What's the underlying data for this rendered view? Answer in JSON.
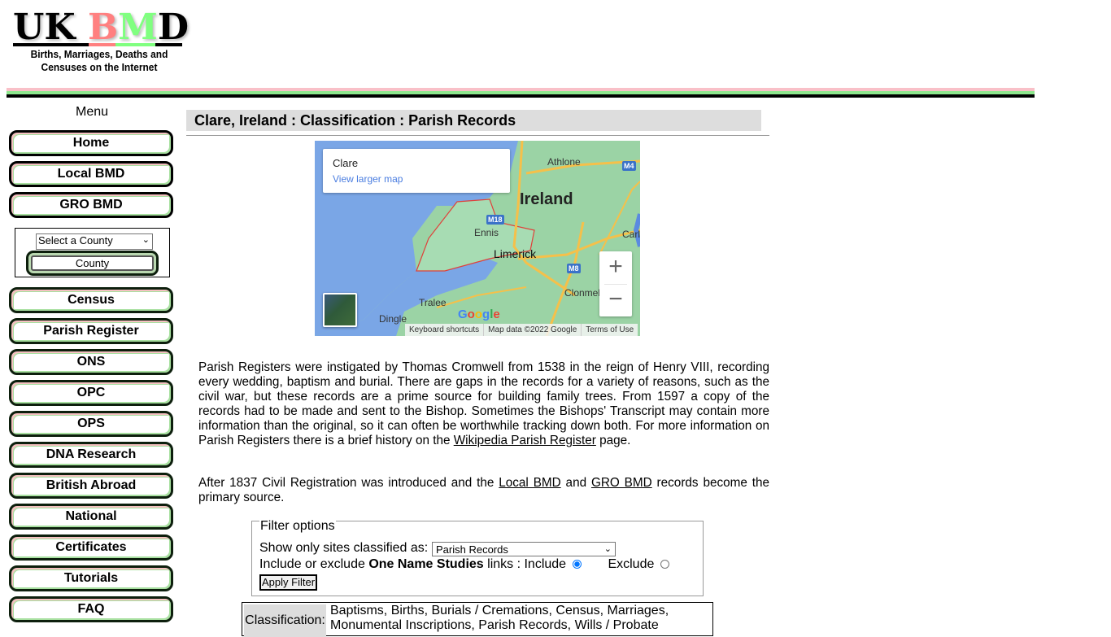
{
  "logo": {
    "title_uk": "UK ",
    "title_b": "B",
    "title_m": "M",
    "title_d": "D",
    "subtitle_line1": "Births, Marriages, Deaths and",
    "subtitle_line2": "Censuses on the Internet"
  },
  "colors": {
    "pink": "#f9c0c8",
    "green": "#8ee88e",
    "black": "#000000",
    "title_bar": "#dddddd"
  },
  "sidebar": {
    "menu_label": "Menu",
    "items_top": [
      {
        "label": "Home"
      },
      {
        "label": "Local BMD"
      },
      {
        "label": "GRO BMD"
      }
    ],
    "county_select": {
      "selected": "Select a County",
      "button_label": "County"
    },
    "items_bottom": [
      {
        "label": "Census"
      },
      {
        "label": "Parish Register"
      },
      {
        "label": "ONS"
      },
      {
        "label": "OPC"
      },
      {
        "label": "OPS"
      },
      {
        "label": "DNA Research"
      },
      {
        "label": "British Abroad"
      },
      {
        "label": "National"
      },
      {
        "label": "Certificates"
      },
      {
        "label": "Tutorials"
      },
      {
        "label": "FAQ"
      }
    ]
  },
  "main": {
    "title": "Clare, Ireland : Classification : Parish Records",
    "map": {
      "place_name": "Clare",
      "view_larger": "View larger map",
      "labels": {
        "ireland": "Ireland",
        "athlone": "Athlone",
        "ennis": "Ennis",
        "limerick": "Limerick",
        "tralee": "Tralee",
        "dingle": "Dingle",
        "clonmel": "Clonmel",
        "carl": "Carl",
        "m4": "M4",
        "m18": "M18",
        "m8": "M8"
      },
      "zoom_in": "+",
      "zoom_out": "−",
      "google": "Google",
      "footer": [
        "Keyboard shortcuts",
        "Map data ©2022 Google",
        "Terms of Use"
      ]
    },
    "para1": {
      "text": "Parish Registers were instigated by Thomas Cromwell from 1538 in the reign of Henry VIII, recording every wedding, baptism and burial. There are gaps in the records for a variety of reasons, such as the civil war, but these records are a prime source for building family trees. From 1597 a copy of the records had to be made and sent to the Bishop. Sometimes the Bishops' Transcript may contain more information than the original, so it can often be worthwhile tracking down both. For more information on Parish Registers there is a brief history on the ",
      "link": "Wikipedia Parish Register",
      "tail": " page."
    },
    "para2": {
      "text1": "After 1837 Civil Registration was introduced and the ",
      "link1": "Local BMD",
      "text2": " and ",
      "link2": "GRO BMD",
      "text3": " records become the primary source."
    },
    "filter": {
      "legend": "Filter options",
      "show_label": "Show only sites classified as: ",
      "selected_class": "Parish Records",
      "ons_prefix": "Include or exclude ",
      "ons_bold": "One Name Studies",
      "ons_suffix": " links : Include",
      "include_checked": true,
      "exclude_label": "Exclude",
      "apply_label": "Apply Filter"
    },
    "classification": {
      "label": "Classification:",
      "value": "Baptisms, Births, Burials / Cremations, Census, Marriages, Monumental Inscriptions, Parish Records, Wills / Probate"
    }
  }
}
